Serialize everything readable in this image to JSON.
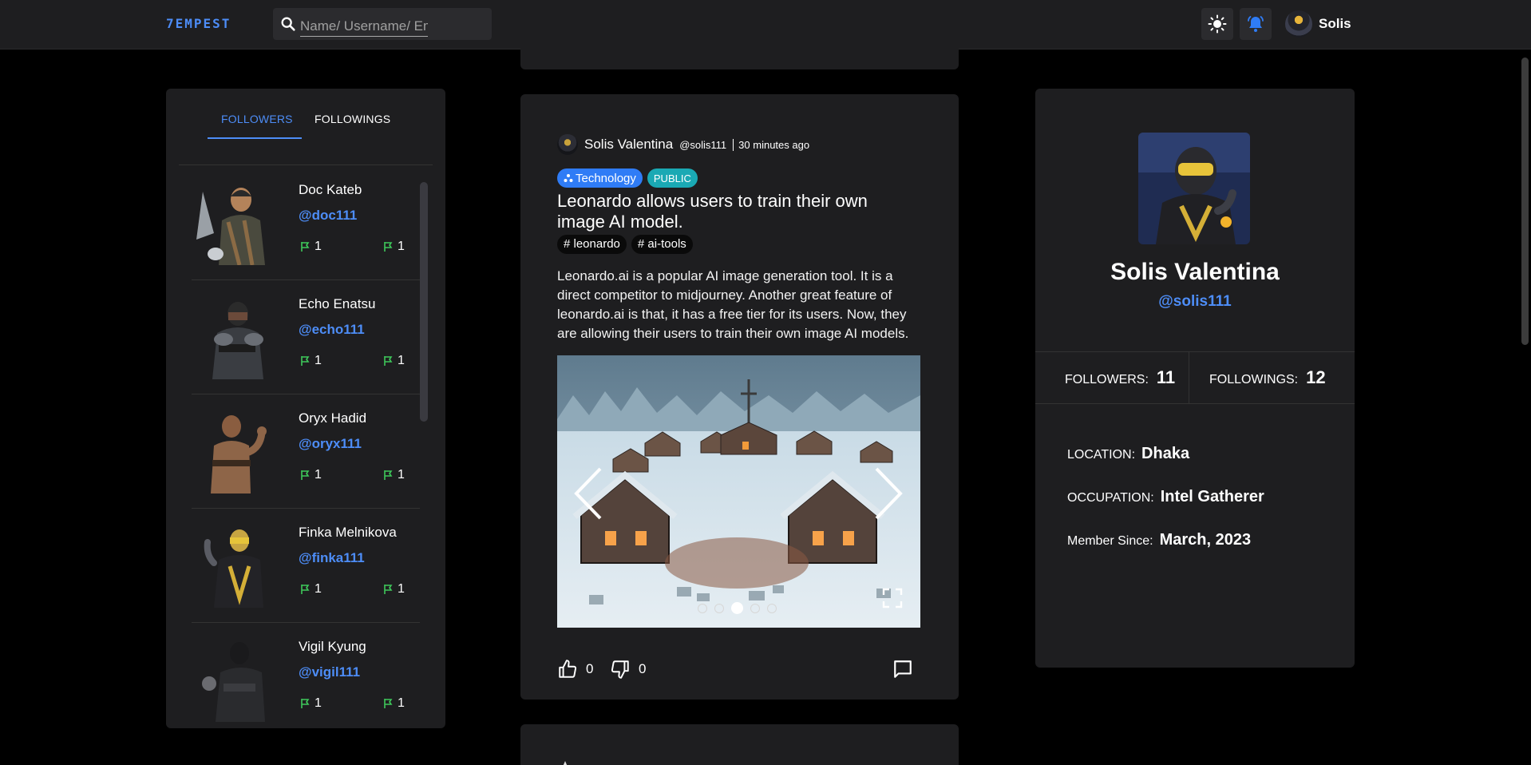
{
  "header": {
    "logo": "7EMPEST",
    "search_placeholder": "Name/ Username/ Email",
    "user_name": "Solis"
  },
  "followers_panel": {
    "tabs": [
      "FOLLOWERS",
      "FOLLOWINGS"
    ],
    "active_tab": "FOLLOWERS",
    "items": [
      {
        "name": "Doc Kateb",
        "username": "@doc111",
        "stat_a": "1",
        "stat_b": "1"
      },
      {
        "name": "Echo Enatsu",
        "username": "@echo111",
        "stat_a": "1",
        "stat_b": "1"
      },
      {
        "name": "Oryx Hadid",
        "username": "@oryx111",
        "stat_a": "1",
        "stat_b": "1"
      },
      {
        "name": "Finka Melnikova",
        "username": "@finka111",
        "stat_a": "1",
        "stat_b": "1"
      },
      {
        "name": "Vigil Kyung",
        "username": "@vigil111",
        "stat_a": "1",
        "stat_b": "1"
      }
    ]
  },
  "post": {
    "author": "Solis Valentina",
    "username": "@solis111",
    "time": "30 minutes ago",
    "category": "Technology",
    "visibility": "PUBLIC",
    "title": "Leonardo allows users to train their own image AI model.",
    "tags": [
      "# leonardo",
      "# ai-tools"
    ],
    "body": "Leonardo.ai is a popular AI image generation tool. It is a direct competitor to midjourney. Another great feature of leonardo.ai is that, it has a free tier for its users. Now, they are allowing their users to train their own image AI models.",
    "carousel_total": 5,
    "carousel_active": 3,
    "likes": "0",
    "dislikes": "0"
  },
  "profile": {
    "name": "Solis Valentina",
    "username": "@solis111",
    "followers_label": "FOLLOWERS:",
    "followers_count": "11",
    "followings_label": "FOLLOWINGS:",
    "followings_count": "12",
    "location_label": "LOCATION:",
    "location": "Dhaka",
    "occupation_label": "OCCUPATION:",
    "occupation": "Intel Gatherer",
    "member_label": "Member Since:",
    "member_since": "March, 2023"
  },
  "colors": {
    "accent": "#4d8df7",
    "panel": "#1e1e20",
    "background": "#000000",
    "public_chip": "#1aa9b4",
    "stat_icon": "#3ec95a"
  }
}
